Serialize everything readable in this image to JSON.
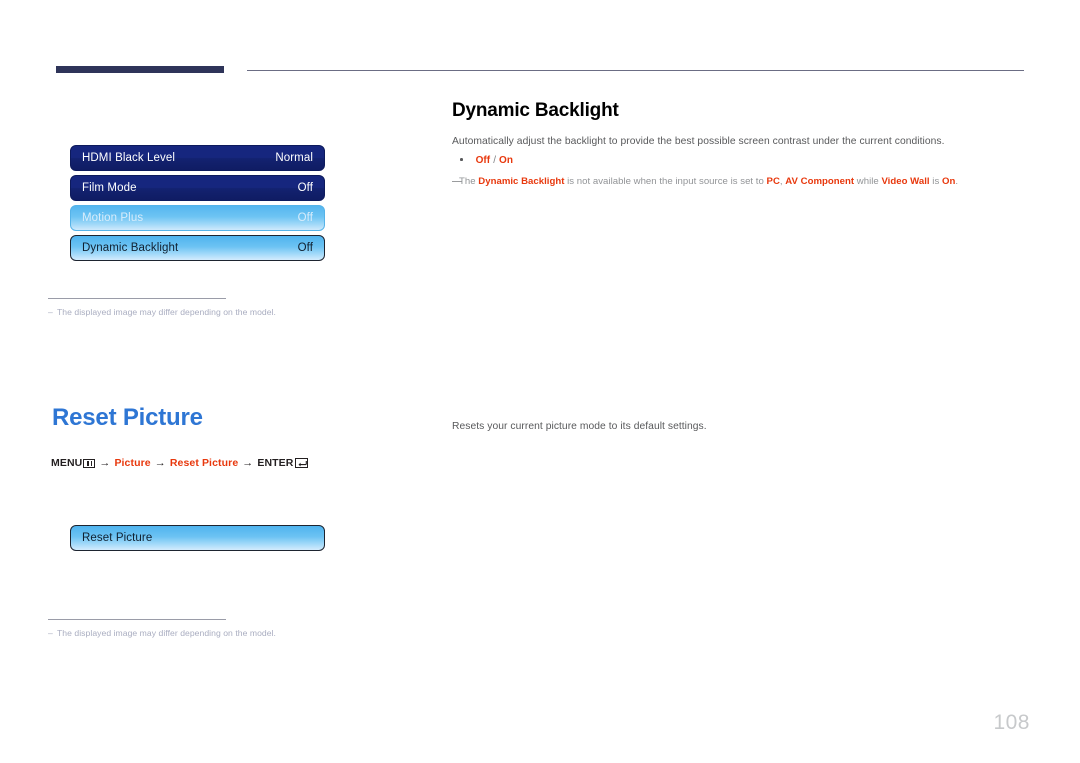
{
  "page": {
    "number": "108"
  },
  "left": {
    "osd_menu_top": {
      "rows": [
        {
          "label": "HDMI Black Level",
          "value": "Normal",
          "state": "normal"
        },
        {
          "label": "Film Mode",
          "value": "Off",
          "state": "normal"
        },
        {
          "label": "Motion Plus",
          "value": "Off",
          "state": "disabled"
        },
        {
          "label": "Dynamic Backlight",
          "value": "Off",
          "state": "selected"
        }
      ]
    },
    "note_top": {
      "dash": "–",
      "text": "The displayed image may differ depending on the model."
    },
    "section": {
      "title": "Reset Picture"
    },
    "breadcrumb": {
      "menu_label": "MENU",
      "menu_icon": "menu-grid-icon",
      "arrow": "→",
      "crumb1": "Picture",
      "crumb2": "Reset Picture",
      "enter_label": "ENTER",
      "enter_icon": "enter-return-icon"
    },
    "osd_menu_bottom": {
      "rows": [
        {
          "label": "Reset Picture",
          "value": "",
          "state": "selected"
        }
      ]
    },
    "note_bottom": {
      "dash": "–",
      "text": "The displayed image may differ depending on the model."
    }
  },
  "right": {
    "heading": "Dynamic Backlight",
    "description": "Automatically adjust the backlight to provide the best possible screen contrast under the current conditions.",
    "bullet": {
      "option_off": "Off",
      "separator": "/",
      "option_on": "On"
    },
    "note": {
      "dash": "—",
      "part1": "The ",
      "term1": "Dynamic Backlight",
      "part2": " is not available when the input source is set to ",
      "term2": "PC",
      "part3": ", ",
      "term3": "AV Component",
      "part4": " while ",
      "term4": "Video Wall",
      "part5": " is ",
      "term5": "On",
      "part6": "."
    },
    "reset_description": "Resets your current picture mode to its default settings."
  },
  "colors": {
    "accent_blue": "#2e76d4",
    "accent_red": "#e8380d",
    "osd_dark": "#16267e",
    "osd_light": "#6dc3f3",
    "rule_navy": "#2e3459"
  }
}
